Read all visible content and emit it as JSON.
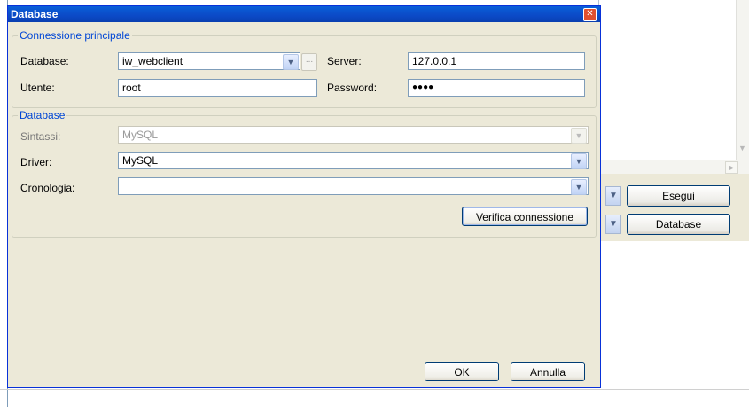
{
  "dialog": {
    "title": "Database",
    "close_glyph": "✕"
  },
  "main_connection": {
    "group_title": "Connessione principale",
    "database_label": "Database:",
    "database_value": "iw_webclient",
    "ellipsis_label": "...",
    "server_label": "Server:",
    "server_value": "127.0.0.1",
    "user_label": "Utente:",
    "user_value": "root",
    "password_label": "Password:",
    "password_value": "●●●●"
  },
  "database_group": {
    "group_title": "Database",
    "syntax_label": "Sintassi:",
    "syntax_value": "MySQL",
    "driver_label": "Driver:",
    "driver_value": "MySQL",
    "history_label": "Cronologia:",
    "history_value": "",
    "verify_button": "Verifica connessione"
  },
  "footer": {
    "ok_button": "OK",
    "cancel_button": "Annulla"
  },
  "background_app": {
    "execute_button": "Esegui",
    "database_button": "Database"
  },
  "icons": {
    "dropdown": "chevron-down-icon",
    "close": "close-icon",
    "scroll_down": "scroll-down-arrow-icon",
    "scroll_right": "scroll-right-arrow-icon"
  }
}
